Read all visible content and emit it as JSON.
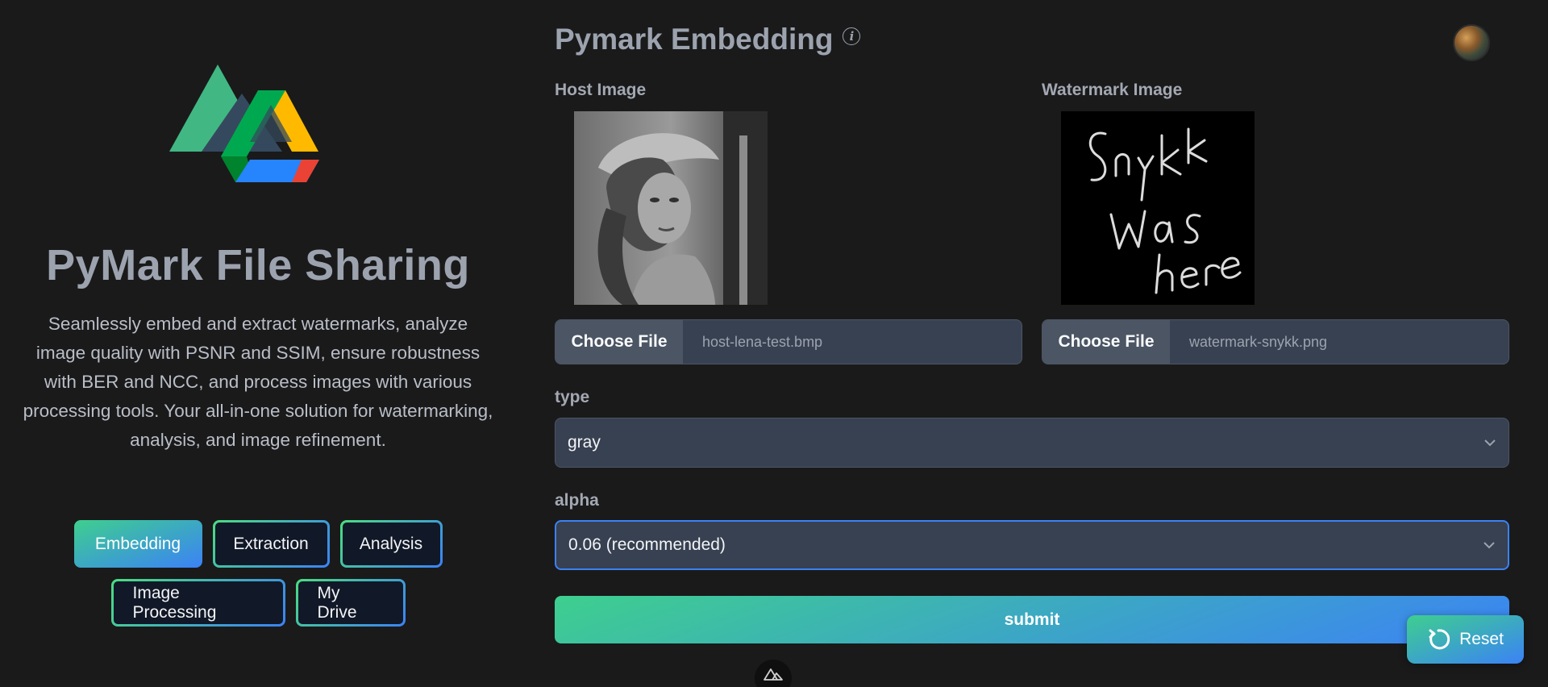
{
  "brand": {
    "title": "PyMark File Sharing",
    "description": "Seamlessly embed and extract watermarks, analyze image quality with PSNR and SSIM, ensure robustness with BER and NCC, and process images with various processing tools. Your all-in-one solution for watermarking, analysis, and image refinement.",
    "logo_icon": "drive-logo-icon"
  },
  "nav": {
    "items": [
      {
        "label": "Embedding",
        "active": true
      },
      {
        "label": "Extraction",
        "active": false
      },
      {
        "label": "Analysis",
        "active": false
      },
      {
        "label": "Image Processing",
        "active": false
      },
      {
        "label": "My Drive",
        "active": false
      }
    ]
  },
  "main": {
    "title": "Pymark Embedding",
    "info_icon": "info-icon",
    "host": {
      "label": "Host Image",
      "choose_label": "Choose File",
      "file_name": "host-lena-test.bmp"
    },
    "watermark": {
      "label": "Watermark Image",
      "choose_label": "Choose File",
      "file_name": "watermark-snykk.png",
      "handwritten_text": "Snykk Was here"
    },
    "type": {
      "label": "type",
      "value": "gray"
    },
    "alpha": {
      "label": "alpha",
      "value": "0.06 (recommended)"
    },
    "submit_label": "submit"
  },
  "reset_label": "Reset",
  "colors": {
    "background": "#1a1a1b",
    "input_bg": "#374151",
    "gradient_start": "#3ecf8e",
    "gradient_end": "#3b82f6",
    "focus_border": "#3b82f6"
  }
}
